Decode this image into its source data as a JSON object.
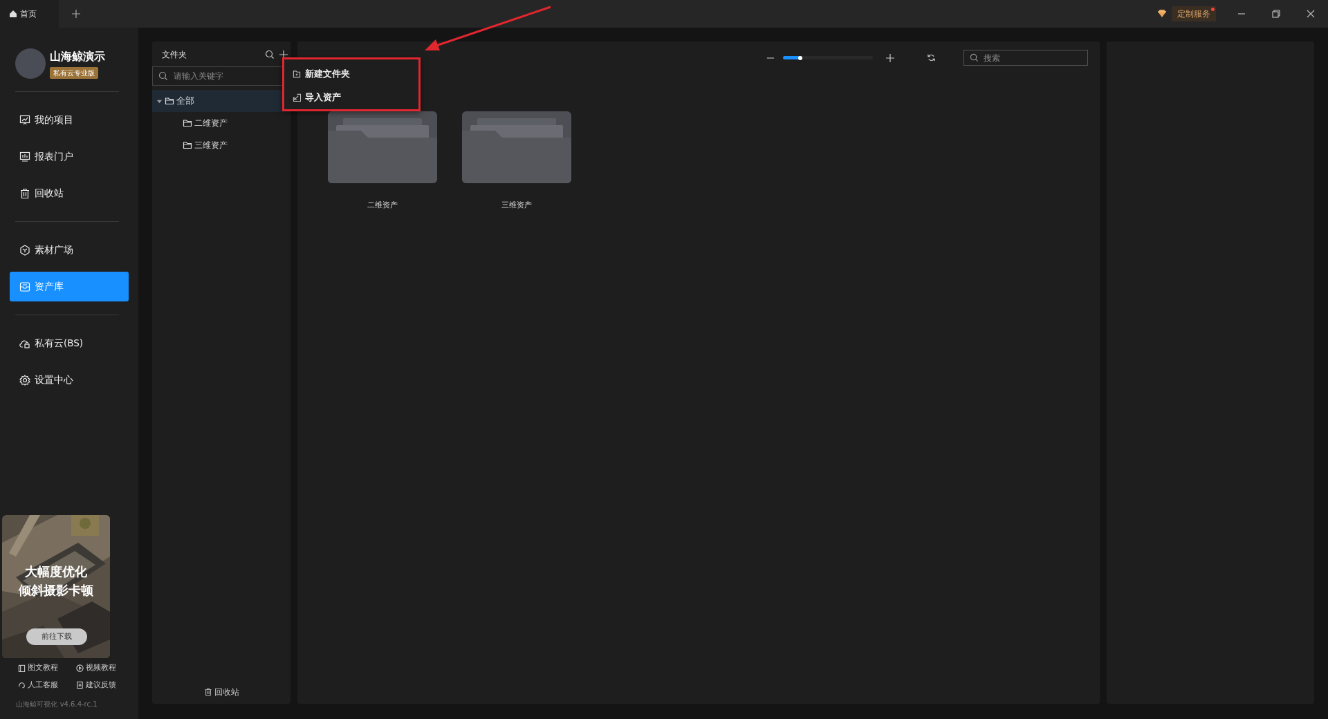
{
  "tabs": [
    {
      "label": "首页",
      "selected": true
    }
  ],
  "title_bar": {
    "service_button": "定制服务",
    "notice": true
  },
  "account": {
    "name": "山海鲸演示",
    "badge": "私有云专业版"
  },
  "nav_groups": [
    [
      {
        "label": "我的项目",
        "selected": false
      },
      {
        "label": "报表门户",
        "selected": false
      },
      {
        "label": "回收站",
        "selected": false
      }
    ],
    [
      {
        "label": "素材广场",
        "selected": false
      },
      {
        "label": "资产库",
        "selected": true
      }
    ],
    [
      {
        "label": "私有云(BS)",
        "selected": false
      },
      {
        "label": "设置中心",
        "selected": false
      }
    ]
  ],
  "banner": {
    "kind": "picture",
    "headline": [
      "大幅度优化",
      "倾斜摄影卡顿"
    ],
    "button": "前往下载"
  },
  "help_links": [
    {
      "label": "图文教程"
    },
    {
      "label": "视频教程"
    },
    {
      "label": "人工客服"
    },
    {
      "label": "建议反馈"
    }
  ],
  "version": "山海鲸可视化 v4.6.4-rc.1",
  "folder_panel": {
    "title": "文件夹",
    "search": {
      "placeholder": "请输入关键字"
    },
    "tree": [
      {
        "label": "全部",
        "selected": true,
        "expanded": true,
        "children": [
          {
            "label": "二维资产",
            "selected": false
          },
          {
            "label": "三维资产",
            "selected": false
          }
        ]
      }
    ],
    "recycle": "回收站"
  },
  "context_menu": [
    {
      "label": "新建文件夹"
    },
    {
      "label": "导入资产"
    }
  ],
  "toolbar": {
    "zoom": {
      "level": 0.2
    },
    "search": {
      "placeholder": "搜索"
    }
  },
  "folders": [
    {
      "name": "二维资产"
    },
    {
      "name": "三维资产"
    }
  ]
}
